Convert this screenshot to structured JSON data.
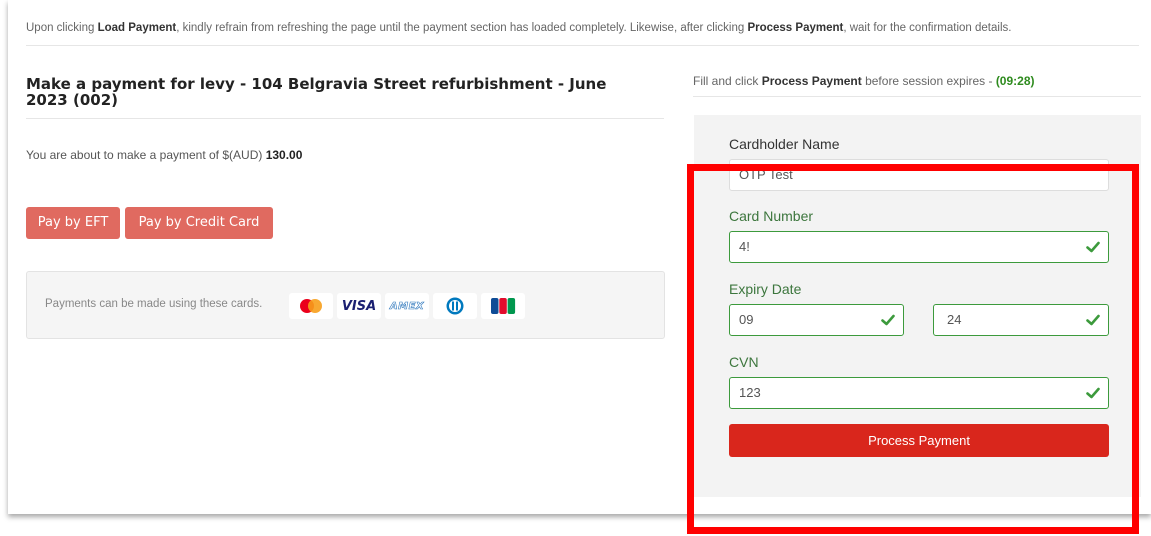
{
  "notice": {
    "part1": "Upon clicking ",
    "load_payment": "Load Payment",
    "part2": ", kindly refrain from refreshing the page until the payment section has loaded completely. Likewise, after clicking ",
    "process_payment": "Process Payment",
    "part3": ", wait for the confirmation details."
  },
  "left": {
    "title": "Make a payment for levy - 104 Belgravia Street refurbishment - June 2023 (002)",
    "amount_prefix": "You are about to make a payment of $(AUD) ",
    "amount": "130.00",
    "pay_eft_label": "Pay by EFT",
    "pay_card_label": "Pay by Credit Card",
    "cards_text": "Payments can be made using these cards.",
    "card_logos": [
      "mastercard-icon",
      "visa-icon",
      "amex-icon",
      "diners-icon",
      "jcb-icon"
    ],
    "visa_text": "VISA",
    "amex_text": "AMEX"
  },
  "right": {
    "intro_prefix": "Fill and click ",
    "intro_bold": "Process Payment",
    "intro_mid": " before session expires - ",
    "timer": "(09:28)",
    "cardholder_label": "Cardholder Name",
    "cardholder_value": "OTP Test",
    "card_number_label": "Card Number",
    "card_number_value": "4!",
    "expiry_label": "Expiry Date",
    "expiry_month": "09",
    "expiry_year": "24",
    "cvn_label": "CVN",
    "cvn_value": "123",
    "process_label": "Process Payment"
  },
  "colors": {
    "accent_red": "#e06a60",
    "process_red": "#d9261c",
    "valid_green": "#3c9a3c",
    "highlight_red": "#ff0000"
  }
}
